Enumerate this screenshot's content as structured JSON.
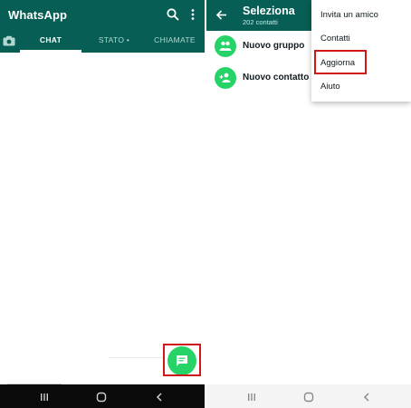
{
  "left": {
    "app_title": "WhatsApp",
    "header_icons": [
      "search-icon",
      "more-vert-icon"
    ],
    "tabs": [
      {
        "label": "CHAT",
        "active": true
      },
      {
        "label": "STATO •",
        "active": false
      },
      {
        "label": "CHIAMATE",
        "active": false
      }
    ],
    "camera_icon": "camera-icon",
    "fab_icon": "new-chat-icon",
    "colors": {
      "header": "#075e54",
      "fab": "#25d366",
      "highlight": "#d01818"
    }
  },
  "right": {
    "title": "Seleziona",
    "subtitle": "202 contatti",
    "rows": [
      {
        "label": "Nuovo gruppo",
        "icon": "group-icon"
      },
      {
        "label": "Nuovo contatto",
        "icon": "add-person-icon"
      }
    ],
    "menu": [
      "Invita un amico",
      "Contatti",
      "Aggiorna",
      "Aiuto"
    ],
    "highlighted_menu_item": "Aggiorna"
  },
  "nav": {
    "icons": [
      "recent-apps-icon",
      "home-icon",
      "back-icon"
    ]
  }
}
